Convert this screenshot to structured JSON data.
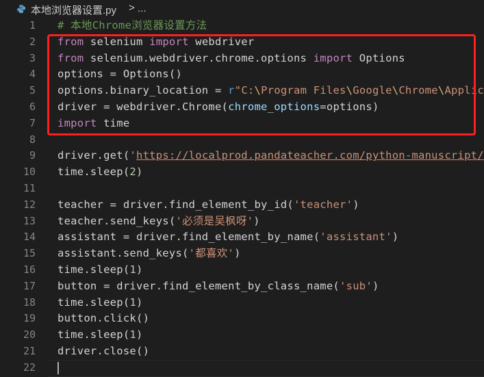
{
  "breadcrumb": {
    "file_icon": "python-file-icon",
    "file_name": "本地浏览器设置.py",
    "separator": ">",
    "more": "..."
  },
  "editor": {
    "highlight_box_color": "#ff1f1f",
    "lines": [
      {
        "n": "1",
        "tokens": [
          [
            "cm",
            "# 本地Chrome浏览器设置方法"
          ]
        ]
      },
      {
        "n": "2",
        "tokens": [
          [
            "kw",
            "from"
          ],
          [
            "",
            " selenium "
          ],
          [
            "kw",
            "import"
          ],
          [
            "",
            " webdriver"
          ]
        ]
      },
      {
        "n": "3",
        "tokens": [
          [
            "kw",
            "from"
          ],
          [
            "",
            " selenium.webdriver.chrome.options "
          ],
          [
            "kw",
            "import"
          ],
          [
            "",
            " Options"
          ]
        ]
      },
      {
        "n": "4",
        "tokens": [
          [
            "",
            "options = Options()"
          ]
        ]
      },
      {
        "n": "5",
        "tokens": [
          [
            "",
            "options.binary_location = "
          ],
          [
            "rpref",
            "r"
          ],
          [
            "str",
            "\"C:"
          ],
          [
            "esc",
            "\\"
          ],
          [
            "str",
            "Program Files"
          ],
          [
            "esc",
            "\\"
          ],
          [
            "str",
            "Google"
          ],
          [
            "esc",
            "\\"
          ],
          [
            "str",
            "Chrome"
          ],
          [
            "esc",
            "\\"
          ],
          [
            "str",
            "Applic"
          ]
        ]
      },
      {
        "n": "6",
        "tokens": [
          [
            "",
            "driver = webdriver.Chrome("
          ],
          [
            "prm",
            "chrome_options"
          ],
          [
            "",
            "=options)"
          ]
        ]
      },
      {
        "n": "7",
        "tokens": [
          [
            "kw",
            "import"
          ],
          [
            "",
            " time"
          ]
        ]
      },
      {
        "n": "8",
        "tokens": []
      },
      {
        "n": "9",
        "tokens": [
          [
            "",
            "driver.get("
          ],
          [
            "str",
            "'"
          ],
          [
            "strl",
            "https://localprod.pandateacher.com/python-manuscript/"
          ]
        ]
      },
      {
        "n": "10",
        "tokens": [
          [
            "",
            "time.sleep("
          ],
          [
            "num",
            "2"
          ],
          [
            "",
            ")"
          ]
        ]
      },
      {
        "n": "11",
        "tokens": []
      },
      {
        "n": "12",
        "tokens": [
          [
            "",
            "teacher = driver.find_element_by_id("
          ],
          [
            "str",
            "'teacher'"
          ],
          [
            "",
            ")"
          ]
        ]
      },
      {
        "n": "13",
        "tokens": [
          [
            "",
            "teacher.send_keys("
          ],
          [
            "str",
            "'必须是吴枫呀'"
          ],
          [
            "",
            ")"
          ]
        ]
      },
      {
        "n": "14",
        "tokens": [
          [
            "",
            "assistant = driver.find_element_by_name("
          ],
          [
            "str",
            "'assistant'"
          ],
          [
            "",
            ")"
          ]
        ]
      },
      {
        "n": "15",
        "tokens": [
          [
            "",
            "assistant.send_keys("
          ],
          [
            "str",
            "'都喜欢'"
          ],
          [
            "",
            ")"
          ]
        ]
      },
      {
        "n": "16",
        "tokens": [
          [
            "",
            "time.sleep("
          ],
          [
            "num",
            "1"
          ],
          [
            "",
            ")"
          ]
        ]
      },
      {
        "n": "17",
        "tokens": [
          [
            "",
            "button = driver.find_element_by_class_name("
          ],
          [
            "str",
            "'sub'"
          ],
          [
            "",
            ")"
          ]
        ]
      },
      {
        "n": "18",
        "tokens": [
          [
            "",
            "time.sleep("
          ],
          [
            "num",
            "1"
          ],
          [
            "",
            ")"
          ]
        ]
      },
      {
        "n": "19",
        "tokens": [
          [
            "",
            "button.click()"
          ]
        ]
      },
      {
        "n": "20",
        "tokens": [
          [
            "",
            "time.sleep("
          ],
          [
            "num",
            "1"
          ],
          [
            "",
            ")"
          ]
        ]
      },
      {
        "n": "21",
        "tokens": [
          [
            "",
            "driver.close()"
          ]
        ]
      },
      {
        "n": "22",
        "tokens": []
      }
    ]
  }
}
